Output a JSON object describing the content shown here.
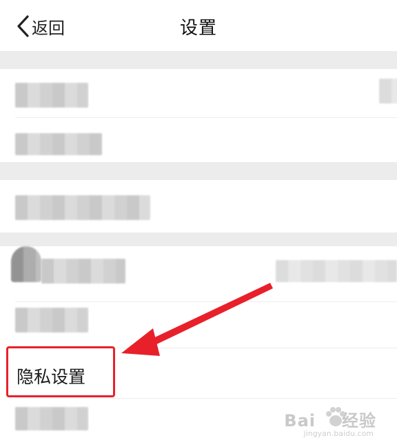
{
  "nav": {
    "back_label": "返回",
    "title": "设置"
  },
  "rows": {
    "privacy_settings": "隐私设置"
  },
  "watermark": {
    "brand": "Bai",
    "suffix": "经验",
    "url": "jingyan.baidu.com"
  },
  "colors": {
    "highlight": "#e8202a",
    "group_gap": "#ececec",
    "background": "#ffffff"
  }
}
